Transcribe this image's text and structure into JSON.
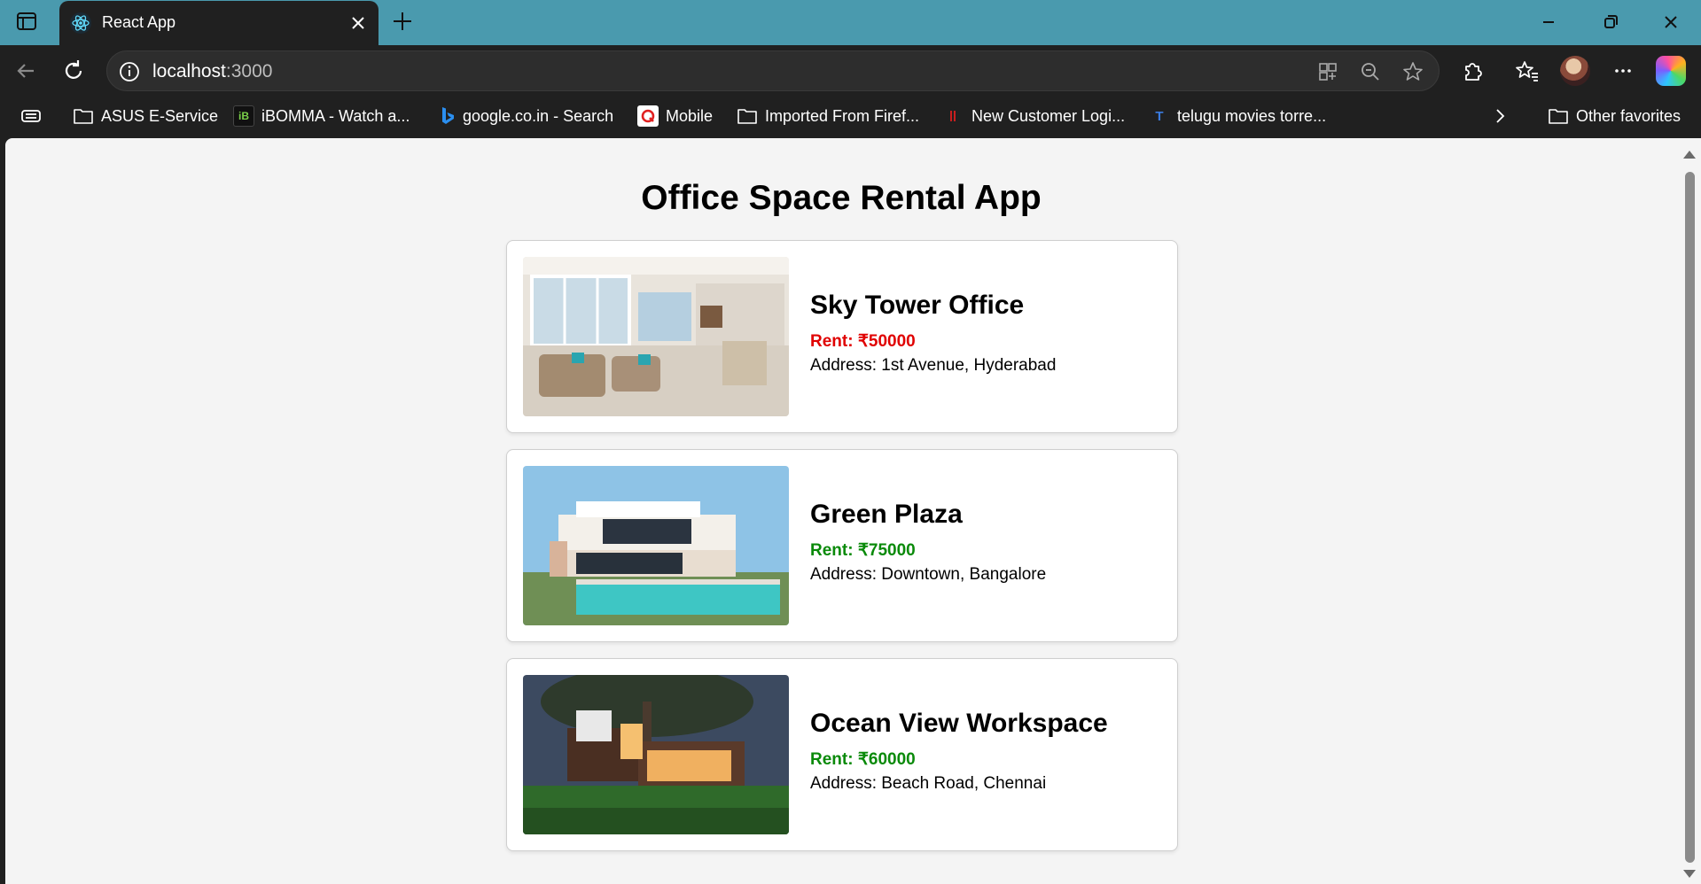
{
  "browser": {
    "tab_title": "React App",
    "url_host": "localhost",
    "url_port": ":3000",
    "favorites": [
      {
        "label": "ASUS E-Service",
        "icon": "folder-icon"
      },
      {
        "label": "iBOMMA - Watch a...",
        "icon": "ibomma-icon"
      },
      {
        "label": "google.co.in - Search",
        "icon": "bing-icon"
      },
      {
        "label": "Mobile",
        "icon": "mobile-app-icon"
      },
      {
        "label": "Imported From Firef...",
        "icon": "folder-icon"
      },
      {
        "label": "New Customer Logi...",
        "icon": "bank-icon"
      },
      {
        "label": "telugu movies torre...",
        "icon": "torrent-site-icon"
      }
    ],
    "other_favorites": "Other favorites"
  },
  "page": {
    "title": "Office Space Rental App",
    "offices": [
      {
        "name": "Sky Tower Office",
        "rent_label": "Rent: ₹50000",
        "address": "Address: 1st Avenue, Hyderabad",
        "rent_color": "#e00000",
        "image": "living-room-photo"
      },
      {
        "name": "Green Plaza",
        "rent_label": "Rent: ₹75000",
        "address": "Address: Downtown, Bangalore",
        "rent_color": "#0a8a0a",
        "image": "villa-pool-photo"
      },
      {
        "name": "Ocean View Workspace",
        "rent_label": "Rent: ₹60000",
        "address": "Address: Beach Road, Chennai",
        "rent_color": "#0a8a0a",
        "image": "modern-house-night-photo"
      }
    ]
  }
}
